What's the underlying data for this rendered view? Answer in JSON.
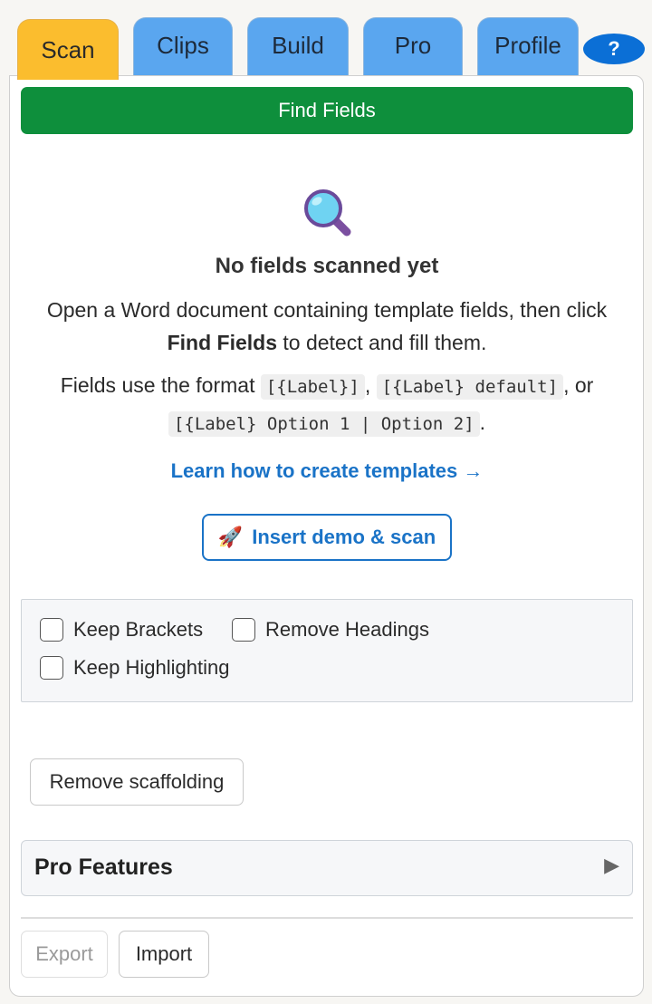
{
  "tabs": [
    {
      "label": "Scan"
    },
    {
      "label": "Clips"
    },
    {
      "label": "Build"
    },
    {
      "label": "Pro"
    },
    {
      "label": "Profile"
    }
  ],
  "active_tab": "Scan",
  "help_label": "?",
  "find_button_label": "Find Fields",
  "empty_state": {
    "icon": "magnifying-glass-icon",
    "title": "No fields scanned yet",
    "desc_before": "Open a Word document containing template fields, then click ",
    "desc_bold": "Find Fields",
    "desc_after": " to detect and fill them.",
    "format_prefix": "Fields use the format ",
    "format_code_1": "[{Label}]",
    "format_sep_1": ", ",
    "format_code_2": "[{Label} default]",
    "format_sep_2": ", or ",
    "format_code_3": "[{Label} Option 1 | Option 2]",
    "format_suffix": "."
  },
  "learn_link": "Learn how to create templates →",
  "demo_button": {
    "icon": "rocket-icon",
    "emoji": "🚀",
    "label": "Insert demo & scan"
  },
  "options": [
    {
      "label": "Keep Brackets",
      "checked": false
    },
    {
      "label": "Remove Headings",
      "checked": false
    },
    {
      "label": "Keep Highlighting",
      "checked": false
    }
  ],
  "scaffold_button": "Remove scaffolding",
  "pro_section": {
    "title": "Pro Features",
    "arrow": "▶"
  },
  "footer": {
    "export_label": "Export",
    "import_label": "Import"
  },
  "colors": {
    "tab_active": "#fbbd2e",
    "tab_inactive": "#5aa6ef",
    "primary_green": "#0e8f3c",
    "link_blue": "#1a73c7",
    "help_blue": "#0b6fd6"
  }
}
